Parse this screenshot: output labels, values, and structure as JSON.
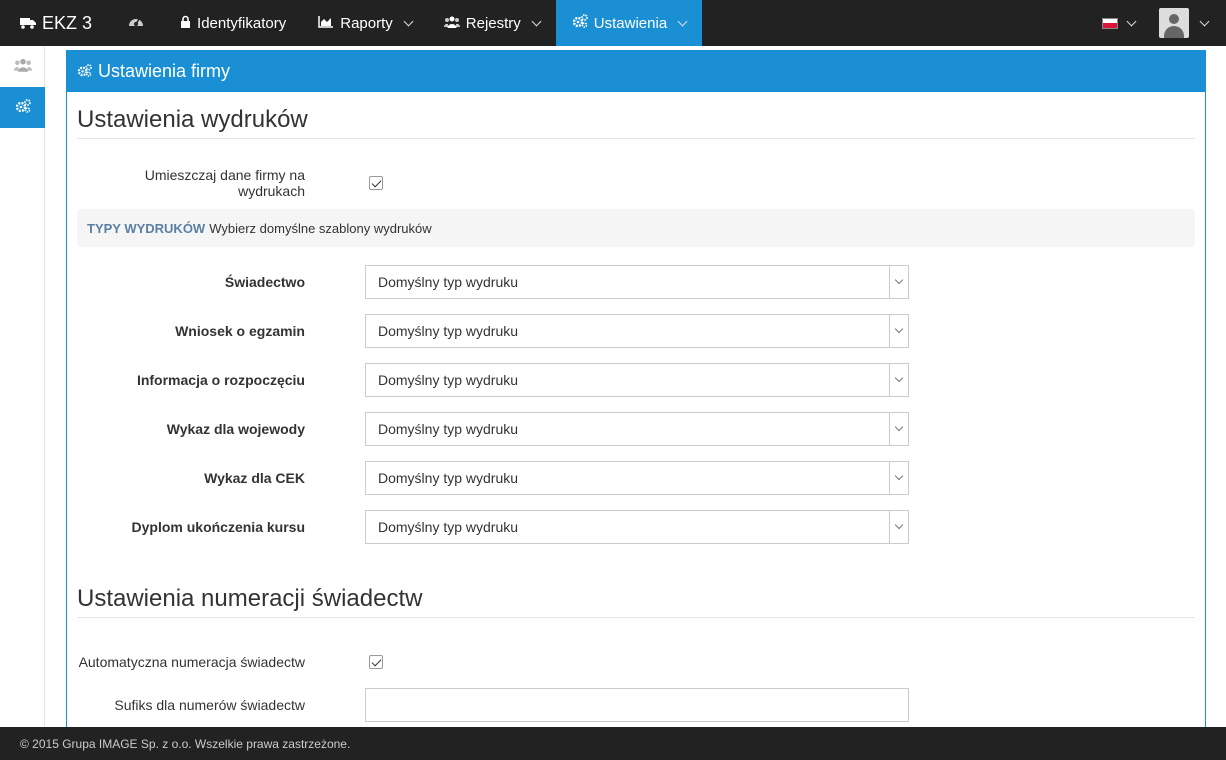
{
  "nav": {
    "brand": "EKZ 3",
    "dashboard_icon": "dashboard-icon",
    "items": [
      {
        "label": "Identyfikatory",
        "icon": "lock-icon"
      },
      {
        "label": "Raporty",
        "icon": "area-chart-icon"
      },
      {
        "label": "Rejestry",
        "icon": "users-icon"
      },
      {
        "label": "Ustawienia",
        "icon": "cogs-icon",
        "active": true
      }
    ],
    "language_flag": "flag-pl-icon",
    "user_icon": "user-avatar-icon"
  },
  "sidebar": {
    "items": [
      {
        "icon": "users-icon",
        "active": false
      },
      {
        "icon": "cogs-icon",
        "active": true
      }
    ]
  },
  "panel": {
    "title": "Ustawienia firmy",
    "print_section": {
      "title": "Ustawienia wydruków",
      "include_company_label": "Umieszczaj dane firmy na wydrukach",
      "include_company_checked": true,
      "well_highlight": "TYPY WYDRUKÓW",
      "well_text": "Wybierz domyślne szablony wydruków",
      "selects": [
        {
          "label": "Świadectwo",
          "value": "Domyślny typ wydruku"
        },
        {
          "label": "Wniosek o egzamin",
          "value": "Domyślny typ wydruku"
        },
        {
          "label": "Informacja o rozpoczęciu",
          "value": "Domyślny typ wydruku"
        },
        {
          "label": "Wykaz dla wojewody",
          "value": "Domyślny typ wydruku"
        },
        {
          "label": "Wykaz dla CEK",
          "value": "Domyślny typ wydruku"
        },
        {
          "label": "Dyplom ukończenia kursu",
          "value": "Domyślny typ wydruku"
        }
      ]
    },
    "numbering_section": {
      "title": "Ustawienia numeracji świadectw",
      "auto_label": "Automatyczna numeracja świadectw",
      "auto_checked": true,
      "suffix_label": "Sufiks dla numerów świadectw",
      "suffix_value": ""
    }
  },
  "footer": {
    "text": "© 2015 Grupa IMAGE Sp. z o.o. Wszelkie prawa zastrzeżone."
  },
  "colors": {
    "accent": "#1a8fd3",
    "navbar": "#222222"
  }
}
